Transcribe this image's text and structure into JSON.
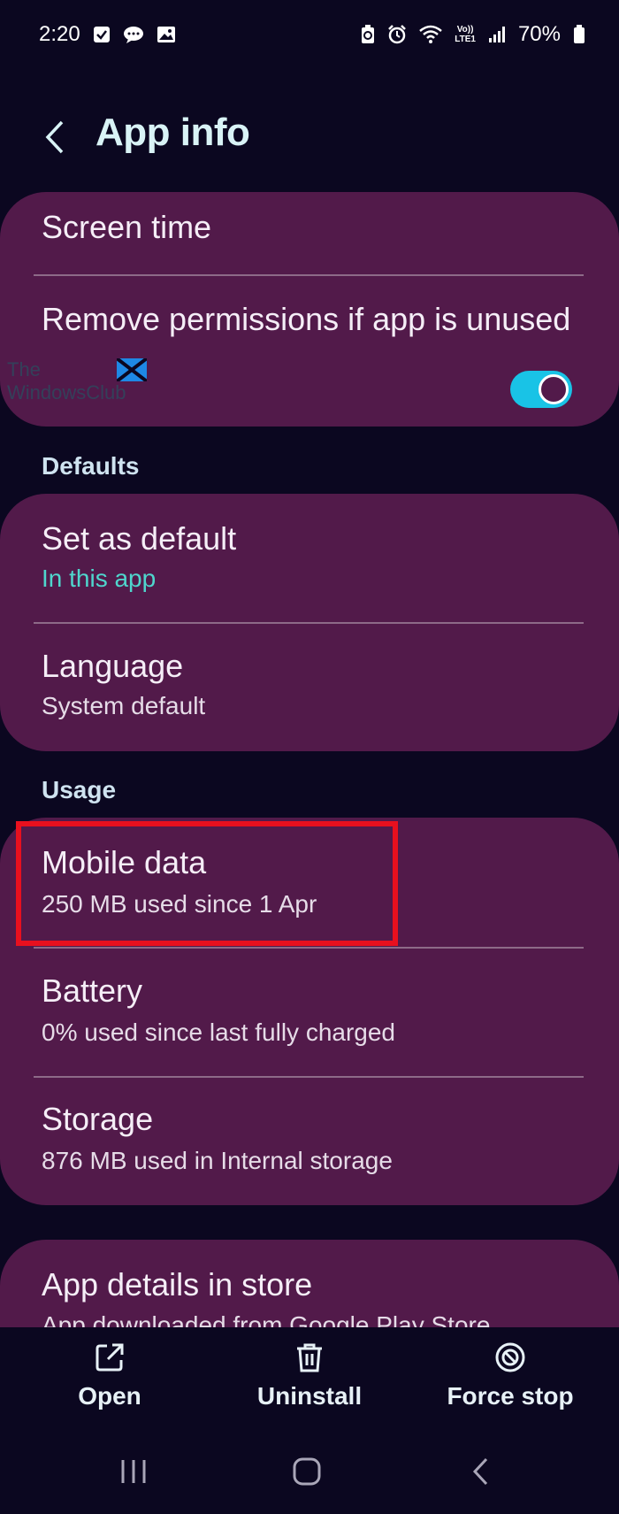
{
  "status_bar": {
    "time": "2:20",
    "battery_percent": "70%",
    "left_icons": [
      "checkbox-notification-icon",
      "chat-bubble-icon",
      "image-icon"
    ],
    "right_icons": [
      "battery-saver-icon",
      "alarm-icon",
      "wifi-icon",
      "volte-icon",
      "signal-icon",
      "battery-icon"
    ],
    "volte_label": "Vo))",
    "lte_label": "LTE1"
  },
  "header": {
    "title": "App info"
  },
  "card1": {
    "screen_time": "Screen time",
    "remove_permissions": "Remove permissions if app is unused",
    "remove_permissions_enabled": true
  },
  "watermark": {
    "line1": "The",
    "line2": "WindowsClub"
  },
  "defaults": {
    "section_label": "Defaults",
    "set_as_default_title": "Set as default",
    "set_as_default_sub": "In this app",
    "language_title": "Language",
    "language_sub": "System default"
  },
  "usage": {
    "section_label": "Usage",
    "mobile_data_title": "Mobile data",
    "mobile_data_sub": "250 MB used since 1 Apr",
    "battery_title": "Battery",
    "battery_sub": "0% used since last fully charged",
    "storage_title": "Storage",
    "storage_sub": "876 MB used in Internal storage"
  },
  "store": {
    "title": "App details in store",
    "sub": "App downloaded from Google Play Store"
  },
  "actions": {
    "open": "Open",
    "uninstall": "Uninstall",
    "force_stop": "Force stop"
  },
  "colors": {
    "background": "#0b0720",
    "card": "#521a4a",
    "accent": "#4fd6cd",
    "toggle": "#19c3e6",
    "highlight": "#e8101e"
  }
}
